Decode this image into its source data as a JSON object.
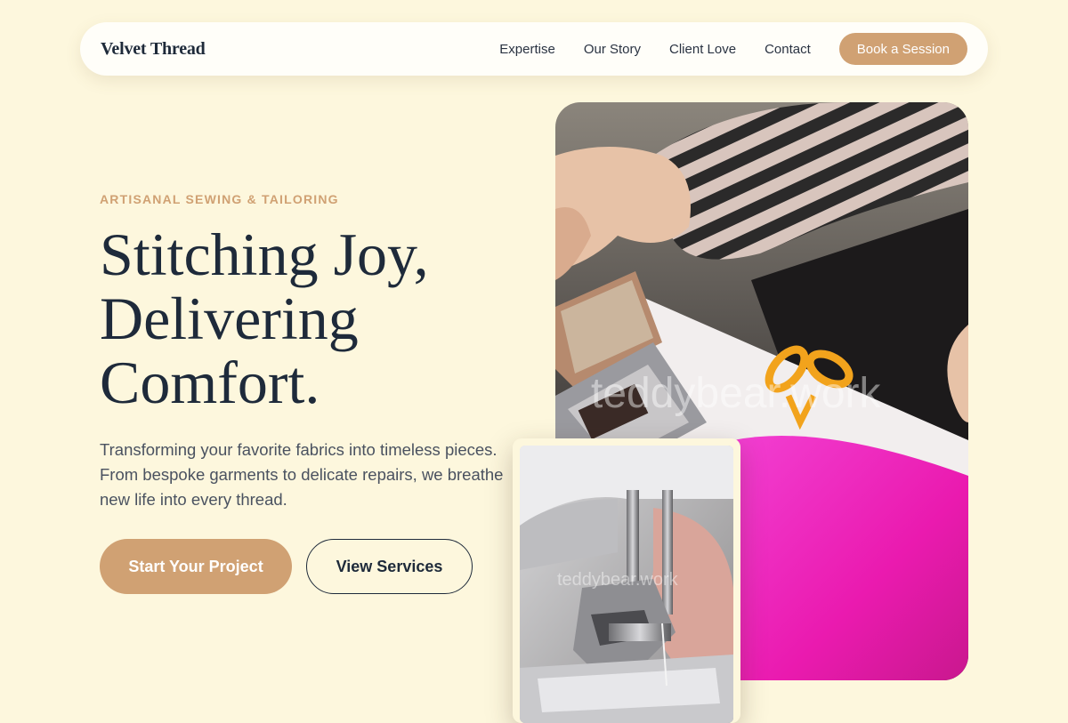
{
  "nav": {
    "brand": "Velvet Thread",
    "links": [
      "Expertise",
      "Our Story",
      "Client Love",
      "Contact"
    ],
    "cta": "Book a Session"
  },
  "hero": {
    "eyebrow": "ARTISANAL SEWING & TAILORING",
    "headline": [
      "Stitching Joy,",
      "Delivering",
      "Comfort."
    ],
    "lede": "Transforming your favorite fabrics into timeless pieces. From bespoke garments to delicate repairs, we breathe new life into every thread.",
    "primary_cta": "Start Your Project",
    "secondary_cta": "View Services"
  },
  "images": {
    "main_watermark": "teddybear.work",
    "small_watermark": "teddybear.work"
  },
  "colors": {
    "background": "#fdf7dd",
    "accent": "#d0a173",
    "ink": "#1e2a3a"
  }
}
